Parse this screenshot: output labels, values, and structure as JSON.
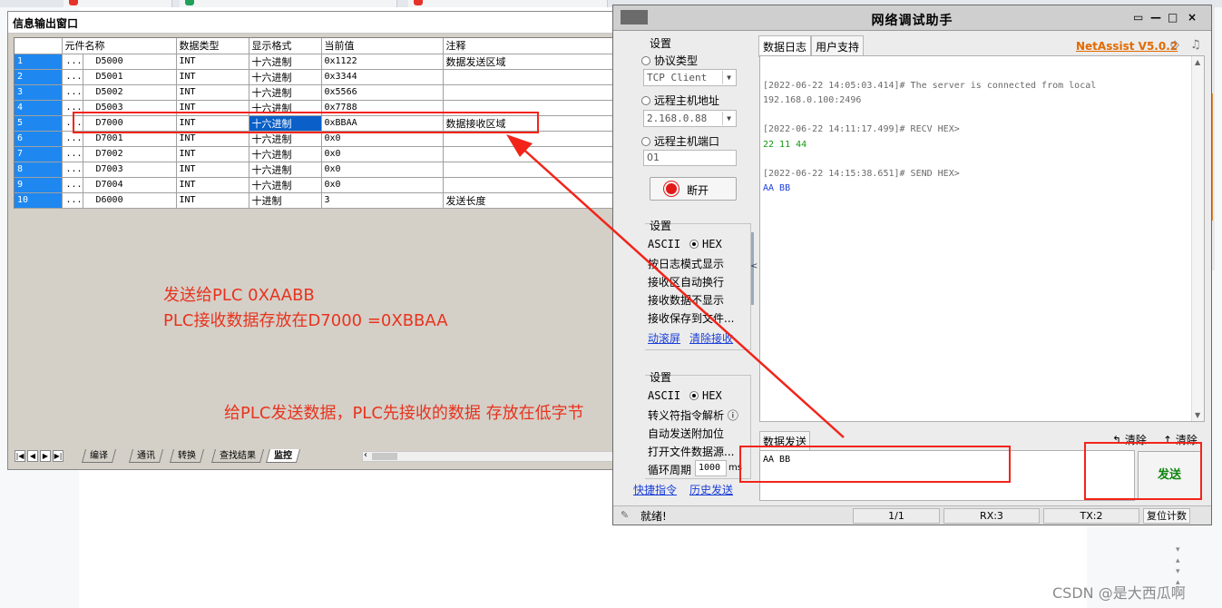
{
  "info_window": {
    "title": "信息输出窗口",
    "close": "×",
    "columns": [
      "",
      "元件名称",
      "数据类型",
      "显示格式",
      "当前值",
      "注释"
    ],
    "rows": [
      {
        "idx": "1",
        "ell": "...",
        "name": "D5000",
        "type": "INT",
        "fmt": "十六进制",
        "value": "0x1122",
        "note": "数据发送区域"
      },
      {
        "idx": "2",
        "ell": "...",
        "name": "D5001",
        "type": "INT",
        "fmt": "十六进制",
        "value": "0x3344",
        "note": ""
      },
      {
        "idx": "3",
        "ell": "...",
        "name": "D5002",
        "type": "INT",
        "fmt": "十六进制",
        "value": "0x5566",
        "note": ""
      },
      {
        "idx": "4",
        "ell": "...",
        "name": "D5003",
        "type": "INT",
        "fmt": "十六进制",
        "value": "0x7788",
        "note": ""
      },
      {
        "idx": "5",
        "ell": "...",
        "name": "D7000",
        "type": "INT",
        "fmt": "十六进制",
        "value": "0xBBAA",
        "note": "数据接收区域"
      },
      {
        "idx": "6",
        "ell": "...",
        "name": "D7001",
        "type": "INT",
        "fmt": "十六进制",
        "value": "0x0",
        "note": ""
      },
      {
        "idx": "7",
        "ell": "...",
        "name": "D7002",
        "type": "INT",
        "fmt": "十六进制",
        "value": "0x0",
        "note": ""
      },
      {
        "idx": "8",
        "ell": "...",
        "name": "D7003",
        "type": "INT",
        "fmt": "十六进制",
        "value": "0x0",
        "note": ""
      },
      {
        "idx": "9",
        "ell": "...",
        "name": "D7004",
        "type": "INT",
        "fmt": "十六进制",
        "value": "0x0",
        "note": ""
      },
      {
        "idx": "10",
        "ell": "...",
        "name": "D6000",
        "type": "INT",
        "fmt": "十进制",
        "value": "3",
        "note": "发送长度"
      }
    ],
    "tabs": [
      "编译",
      "通讯",
      "转换",
      "查找结果",
      "监控"
    ],
    "nav": [
      "|◀",
      "◀",
      "▶",
      "▶|"
    ]
  },
  "annotations": {
    "line1": "发送给PLC  0XAABB",
    "line2": "PLC接收数据存放在D7000    =0XBBAA",
    "line3": "给PLC发送数据，PLC先接收的数据 存放在低字节",
    "color": "#e8331e"
  },
  "netassist": {
    "title": "网络调试助手",
    "controls": [
      "▭",
      "—",
      "□",
      "×"
    ],
    "net_settings": {
      "group": "设置",
      "protocol_label": "协议类型",
      "protocol_value": "TCP Client",
      "remote_addr_label": "远程主机地址",
      "remote_addr_value": "2.168.0.88",
      "remote_port_label": "远程主机端口",
      "remote_port_value": "01",
      "open_button": "断开"
    },
    "recv_settings": {
      "group": "设置",
      "ascii": "ASCII",
      "hex": "HEX",
      "opt1": "按日志模式显示",
      "opt2": "接收区自动换行",
      "opt3": "接收数据不显示",
      "opt4": "接收保存到文件...",
      "link1": "动滚屏",
      "link2": "清除接收"
    },
    "send_settings": {
      "group": "设置",
      "ascii": "ASCII",
      "hex": "HEX",
      "opt1": "转义符指令解析",
      "opt2": "自动发送附加位",
      "opt3": "打开文件数据源...",
      "opt4": "循环周期",
      "period": "1000",
      "unit": "ms",
      "link1": "快捷指令",
      "link2": "历史发送",
      "info": "ⓘ"
    },
    "tabs": [
      "数据日志",
      "用户支持"
    ],
    "brand": "NetAssist V5.0.2",
    "log": [
      {
        "text": "[2022-06-22 14:05:03.414]# The server is connected from local",
        "cls": ""
      },
      {
        "text": "192.168.0.100:2496",
        "cls": ""
      },
      {
        "text": "[2022-06-22 14:11:17.499]# RECV HEX>",
        "cls": ""
      },
      {
        "text": "22 11 44",
        "cls": "green"
      },
      {
        "text": "[2022-06-22 14:15:38.651]# SEND HEX>",
        "cls": ""
      },
      {
        "text": "AA BB",
        "cls": "blue"
      }
    ],
    "send_header": "数据发送",
    "clear1": "清除",
    "clear2": "清除",
    "send_text": "AA BB",
    "send_button": "发送",
    "status": {
      "ready": "就绪!",
      "pages": "1/1",
      "rx": "RX:3",
      "tx": "TX:2",
      "reset": "复位计数"
    }
  },
  "watermark": "CSDN @是大西瓜啊"
}
